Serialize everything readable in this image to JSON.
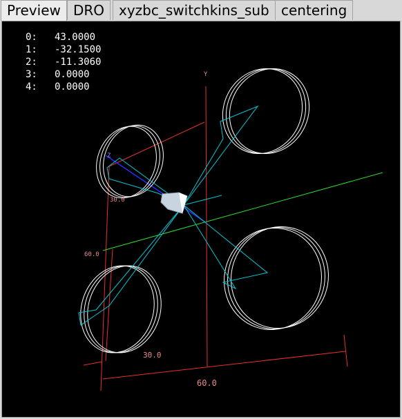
{
  "tabs": [
    {
      "label": "Preview",
      "active": true
    },
    {
      "label": "DRO",
      "active": false
    },
    {
      "label": "xyzbc_switchkins_sub",
      "active": false
    },
    {
      "label": "centering",
      "active": false
    }
  ],
  "readout": [
    {
      "index": "0:",
      "value": "43.0000"
    },
    {
      "index": "1:",
      "value": "-32.1500"
    },
    {
      "index": "2:",
      "value": "-11.3060"
    },
    {
      "index": "3:",
      "value": "0.0000"
    },
    {
      "index": "4:",
      "value": "0.0000"
    }
  ],
  "axis_labels": {
    "y_axis": "Y",
    "z_axis": "Z",
    "dim_30_upper": "30.0",
    "dim_60_left": "60.0",
    "dim_30_bottom": "30.0",
    "dim_60_bottom": "60.0"
  },
  "colors": {
    "extents": "#e8312d",
    "toolpath": "#00c8d8",
    "feed": "#ffffff",
    "x_axis": "#2fdc2f",
    "z_axis": "#2a2aff",
    "dim_text": "#e88a8a",
    "tool": "#c8d4e0"
  },
  "icons": {
    "tool": "tool-cone-icon"
  }
}
